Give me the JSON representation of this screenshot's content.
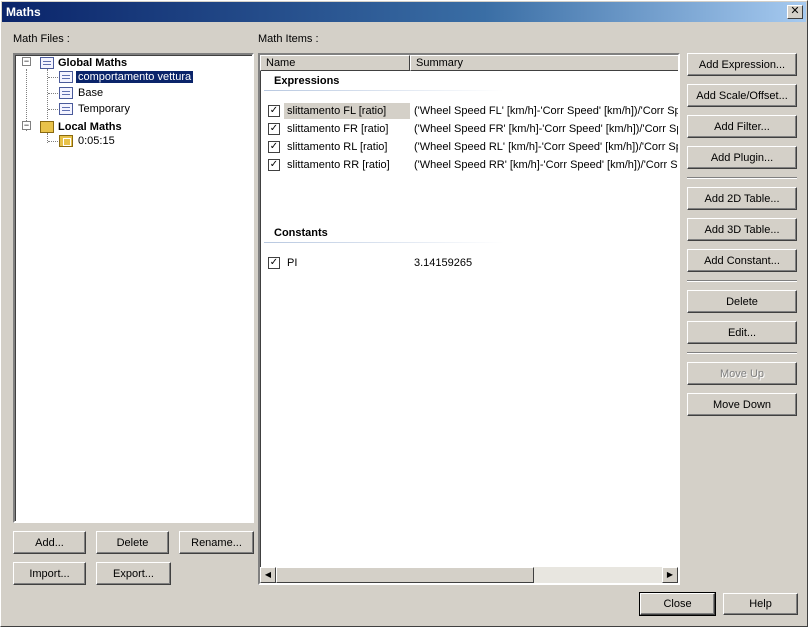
{
  "window": {
    "title": "Maths",
    "close_glyph": "✕"
  },
  "labels": {
    "math_files": "Math Files :",
    "math_items": "Math Items :"
  },
  "tree": {
    "global": {
      "label": "Global Maths",
      "children": [
        "comportamento vettura",
        "Base",
        "Temporary"
      ]
    },
    "local": {
      "label": "Local Maths",
      "children": [
        "0:05:15"
      ]
    },
    "expander_glyph": "−"
  },
  "files_buttons": {
    "add": "Add...",
    "delete": "Delete",
    "rename": "Rename...",
    "import": "Import...",
    "export": "Export..."
  },
  "list": {
    "columns": {
      "name": "Name",
      "summary": "Summary"
    },
    "groups": {
      "expressions": "Expressions",
      "constants": "Constants"
    },
    "check_glyph": "✓",
    "expressions": [
      {
        "name": "slittamento FL [ratio]",
        "summary": "('Wheel Speed FL' [km/h]-'Corr Speed' [km/h])/'Corr Spe"
      },
      {
        "name": "slittamento FR [ratio]",
        "summary": "('Wheel Speed FR' [km/h]-'Corr Speed' [km/h])/'Corr Spe"
      },
      {
        "name": "slittamento RL [ratio]",
        "summary": "('Wheel Speed RL' [km/h]-'Corr Speed' [km/h])/'Corr Spe"
      },
      {
        "name": "slittamento RR [ratio]",
        "summary": "('Wheel Speed RR' [km/h]-'Corr Speed' [km/h])/'Corr Spe"
      }
    ],
    "constants": [
      {
        "name": "PI",
        "summary": "3.14159265"
      }
    ],
    "scroll_left": "◀",
    "scroll_right": "▶"
  },
  "actions": {
    "add_expression": "Add Expression...",
    "add_scale_offset": "Add Scale/Offset...",
    "add_filter": "Add Filter...",
    "add_plugin": "Add Plugin...",
    "add_2d_table": "Add 2D Table...",
    "add_3d_table": "Add 3D Table...",
    "add_constant": "Add Constant...",
    "delete": "Delete",
    "edit": "Edit...",
    "move_up": "Move Up",
    "move_down": "Move Down"
  },
  "footer": {
    "close": "Close",
    "help": "Help"
  }
}
